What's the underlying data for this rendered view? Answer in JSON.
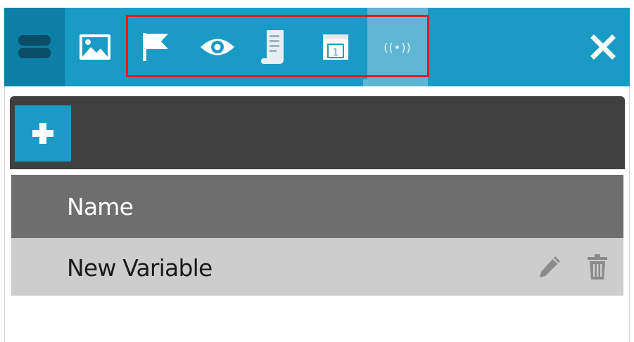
{
  "toolbar": {
    "tools": [
      {
        "name": "layers",
        "icon": "layers-icon",
        "active": true
      },
      {
        "name": "image",
        "icon": "image-icon",
        "active": false
      },
      {
        "name": "flag",
        "icon": "flag-icon",
        "active": false
      },
      {
        "name": "eye",
        "icon": "eye-icon",
        "active": false
      },
      {
        "name": "scroll",
        "icon": "scroll-icon",
        "active": false
      },
      {
        "name": "calendar",
        "icon": "calendar-icon",
        "active": false
      },
      {
        "name": "broadcast",
        "icon": "broadcast-icon",
        "active": true
      },
      {
        "name": "close",
        "icon": "close-icon",
        "active": false
      }
    ],
    "calendar_day": "1",
    "broadcast_glyph": "((•))"
  },
  "panel": {
    "add_icon": "plus-icon",
    "table": {
      "columns": [
        "Name"
      ],
      "rows": [
        {
          "name": "New Variable",
          "actions": [
            "pencil-icon",
            "trash-icon"
          ]
        }
      ]
    }
  },
  "colors": {
    "accent": "#1a9bc5",
    "accent_dark": "#0d7fa5",
    "accent_active": "#5fb6d3",
    "highlight": "#e01b24",
    "panel_header": "#3f3f3f",
    "table_header": "#6e6e6e",
    "table_row": "#cdcdcd"
  }
}
